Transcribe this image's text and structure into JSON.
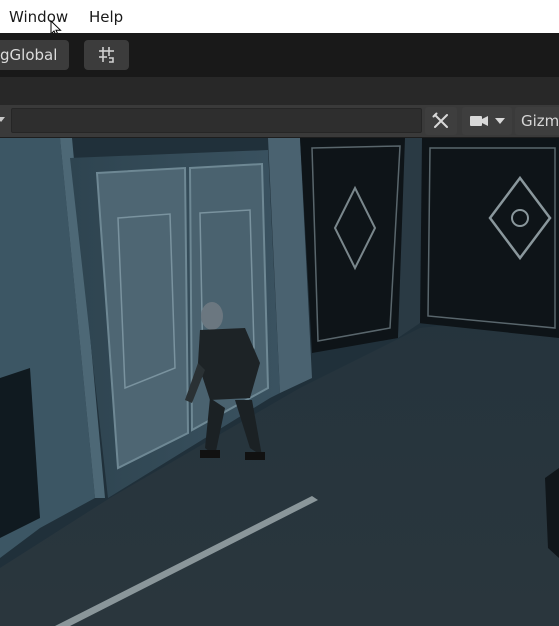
{
  "menubar": {
    "items": [
      "Window",
      "Help"
    ]
  },
  "toolbar": {
    "global_label": "gGlobal"
  },
  "scene_toolbar": {
    "gizmos_label": "Gizm"
  },
  "colors": {
    "menubar_bg": "#ffffff",
    "toolbar_bg": "#191919",
    "scene_toolbar_bg": "#3a3a3a",
    "viewport_tint": "#1a2a33"
  }
}
